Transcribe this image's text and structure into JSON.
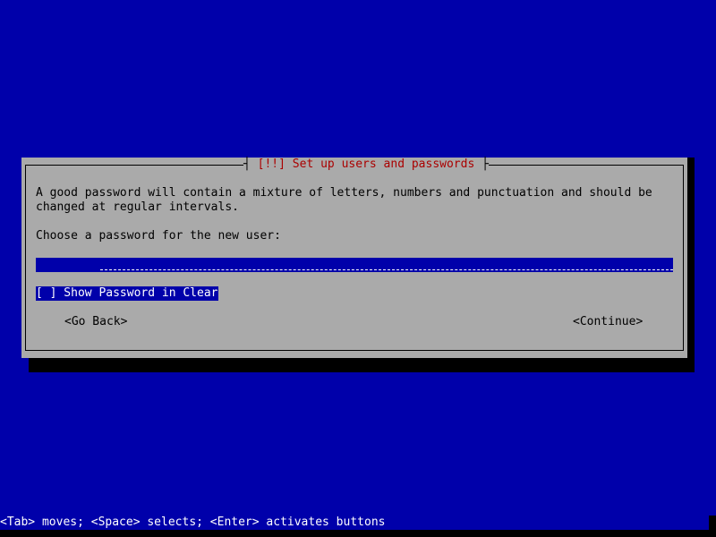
{
  "dialog": {
    "title": "[!!] Set up users and passwords",
    "description_line1": "A good password will contain a mixture of letters, numbers and punctuation and should be",
    "description_line2": "changed at regular intervals.",
    "prompt": "Choose a password for the new user:",
    "password_value": "******",
    "show_password_checkbox": {
      "label": "[ ] Show Password in Clear",
      "checked": false
    },
    "buttons": {
      "go_back": "<Go Back>",
      "continue": "<Continue>"
    }
  },
  "status_bar": {
    "help_text": "<Tab> moves; <Space> selects; <Enter> activates buttons"
  },
  "colors": {
    "background": "#0000aa",
    "dialog": "#aaaaaa",
    "title_text": "#aa0000",
    "highlight": "#0000aa"
  }
}
